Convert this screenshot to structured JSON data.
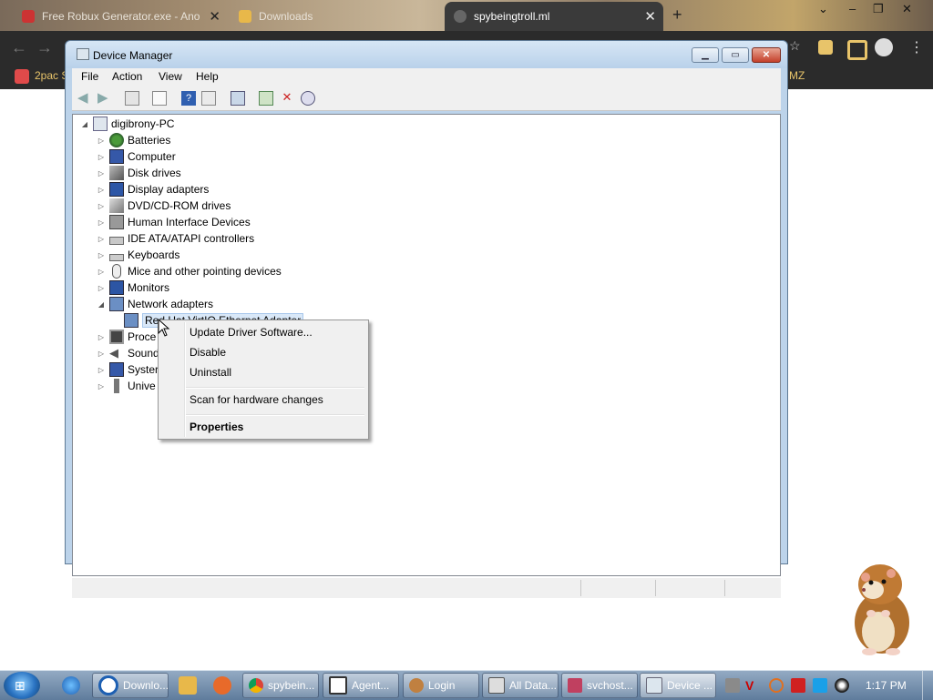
{
  "browser": {
    "tabs": [
      {
        "label": "Free Robux Generator.exe - Ano",
        "active": false
      },
      {
        "label": "Downloads",
        "active": false
      },
      {
        "label": "spybeingtroll.ml",
        "active": true
      }
    ],
    "bookmarks": {
      "first": "2pac S",
      "last": "MZ"
    }
  },
  "device_manager": {
    "title": "Device Manager",
    "menu": [
      "File",
      "Action",
      "View",
      "Help"
    ],
    "tree": {
      "root": "digibrony-PC",
      "categories": [
        {
          "label": "Batteries",
          "icon": "battery-icon"
        },
        {
          "label": "Computer",
          "icon": "computer-icon"
        },
        {
          "label": "Disk drives",
          "icon": "disk-drive-icon"
        },
        {
          "label": "Display adapters",
          "icon": "display-adapter-icon"
        },
        {
          "label": "DVD/CD-ROM drives",
          "icon": "dvd-drive-icon"
        },
        {
          "label": "Human Interface Devices",
          "icon": "hid-icon"
        },
        {
          "label": "IDE ATA/ATAPI controllers",
          "icon": "ide-controller-icon"
        },
        {
          "label": "Keyboards",
          "icon": "keyboard-icon"
        },
        {
          "label": "Mice and other pointing devices",
          "icon": "mouse-icon"
        },
        {
          "label": "Monitors",
          "icon": "monitor-icon"
        },
        {
          "label": "Network adapters",
          "icon": "network-adapter-icon",
          "expanded": true
        }
      ],
      "network_child": "Red Hat VirtIO Ethernet Adapter",
      "partial_categories": [
        {
          "label": "Proce",
          "icon": "processor-icon"
        },
        {
          "label": "Sound",
          "icon": "sound-icon"
        },
        {
          "label": "Syster",
          "icon": "system-icon"
        },
        {
          "label": "Unive",
          "icon": "usb-icon"
        }
      ]
    }
  },
  "context_menu": {
    "items": [
      "Update Driver Software...",
      "Disable",
      "Uninstall"
    ],
    "scan": "Scan for hardware changes",
    "properties": "Properties"
  },
  "taskbar": {
    "buttons": [
      {
        "label": "Downlo...",
        "icon": "ie-window-icon"
      },
      {
        "label": "spybein...",
        "icon": "chrome-icon"
      },
      {
        "label": "Agent...",
        "icon": "agent-icon"
      },
      {
        "label": "Login",
        "icon": "login-icon"
      },
      {
        "label": "All Data...",
        "icon": "data-icon"
      },
      {
        "label": "svchost...",
        "icon": "svchost-icon"
      },
      {
        "label": "Device ...",
        "icon": "device-manager-icon"
      }
    ],
    "clock": "1:17 PM"
  }
}
